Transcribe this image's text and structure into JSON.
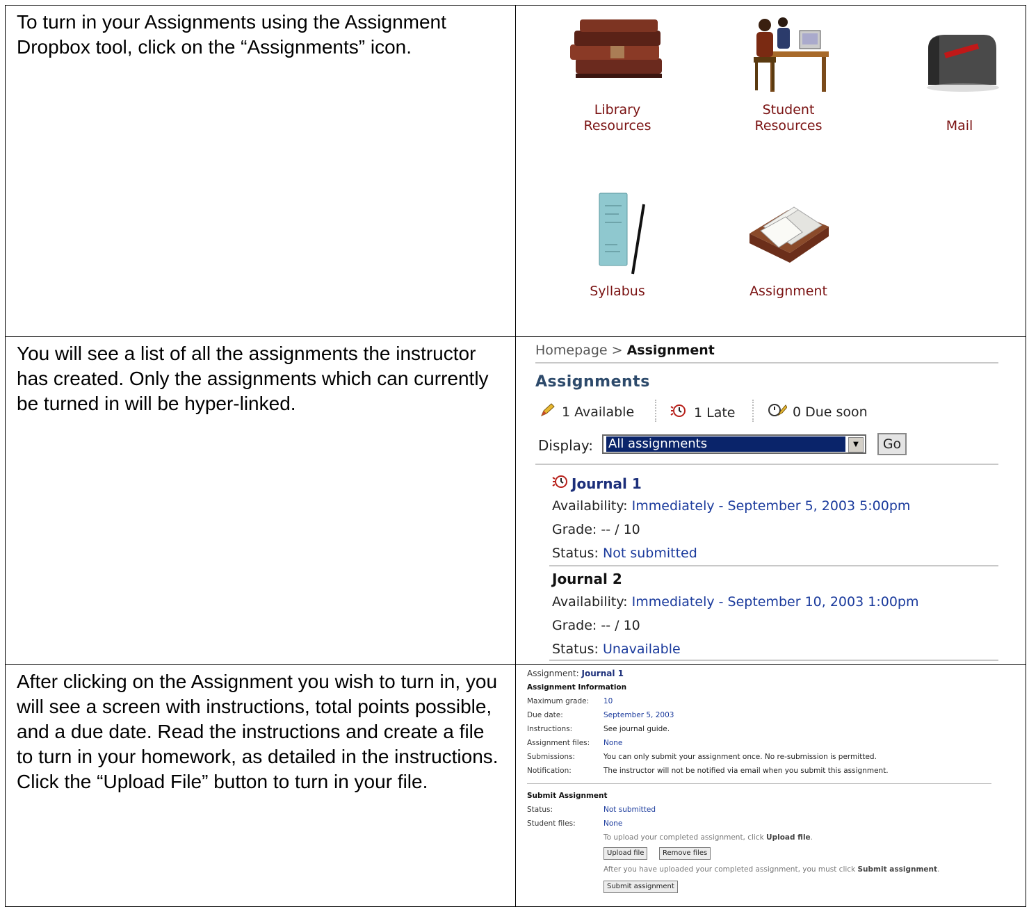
{
  "rows": [
    {
      "instruction": "To turn in your Assignments using the Assignment Dropbox tool, click on the “Assignments” icon.",
      "icons": [
        {
          "label": "Library\nResources",
          "icon": "books-icon"
        },
        {
          "label": "Student\nResources",
          "icon": "student-desk-icon"
        },
        {
          "label": "Mail",
          "icon": "mailbox-icon"
        },
        {
          "label": "Syllabus",
          "icon": "syllabus-icon"
        },
        {
          "label": "Assignment",
          "icon": "inbox-tray-icon"
        }
      ]
    },
    {
      "instruction": "You will see a list of all the assignments the instructor has created. Only the assignments which can currently be turned in will be hyper-linked.",
      "breadcrumb": {
        "home": "Homepage",
        "sep": ">",
        "current": "Assignment"
      },
      "heading": "Assignments",
      "counters": [
        {
          "text": "1 Available",
          "icon": "pencil-icon"
        },
        {
          "text": "1 Late",
          "icon": "late-clock-icon"
        },
        {
          "text": "0 Due soon",
          "icon": "due-soon-icon"
        }
      ],
      "display_label": "Display:",
      "display_value": "All assignments",
      "go_label": "Go",
      "assignments": [
        {
          "title": "Journal 1",
          "availability_label": "Availability:",
          "availability": "Immediately - September 5, 2003 5:00pm",
          "grade_label": "Grade:",
          "grade": "-- / 10",
          "status_label": "Status:",
          "status": "Not submitted"
        },
        {
          "title": "Journal 2",
          "availability_label": "Availability:",
          "availability": "Immediately - September 10, 2003 1:00pm",
          "grade_label": "Grade:",
          "grade": "-- / 10",
          "status_label": "Status:",
          "status": "Unavailable"
        }
      ]
    },
    {
      "instruction": "After clicking on the Assignment you wish to turn in, you will see a screen with instructions, total points possible, and a due date. Read the instructions and create a file to turn in your homework, as detailed in the instructions. Click the “Upload File” button to turn in your file.",
      "assignment_label": "Assignment:",
      "assignment_name": "Journal 1",
      "info_heading": "Assignment Information",
      "info": [
        {
          "label": "Maximum grade:",
          "value": "10"
        },
        {
          "label": "Due date:",
          "value": "September 5, 2003"
        },
        {
          "label": "Instructions:",
          "value": "See journal guide."
        },
        {
          "label": "Assignment files:",
          "value": "None"
        },
        {
          "label": "Submissions:",
          "value": "You can only submit your assignment once. No re-submission is permitted."
        },
        {
          "label": "Notification:",
          "value": "The instructor will not be notified via email when you submit this assignment."
        }
      ],
      "submit_heading": "Submit Assignment",
      "status_label": "Status:",
      "status_value": "Not submitted",
      "files_label": "Student files:",
      "files_value": "None",
      "upload_hint_pre": "To upload your completed assignment, click",
      "upload_hint_bold": "Upload file",
      "upload_hint_post": ".",
      "upload_button": "Upload file",
      "remove_button": "Remove files",
      "submit_hint_pre": "After you have uploaded your completed assignment, you must click",
      "submit_hint_bold": "Submit assignment",
      "submit_hint_post": ".",
      "submit_button": "Submit assignment"
    }
  ]
}
